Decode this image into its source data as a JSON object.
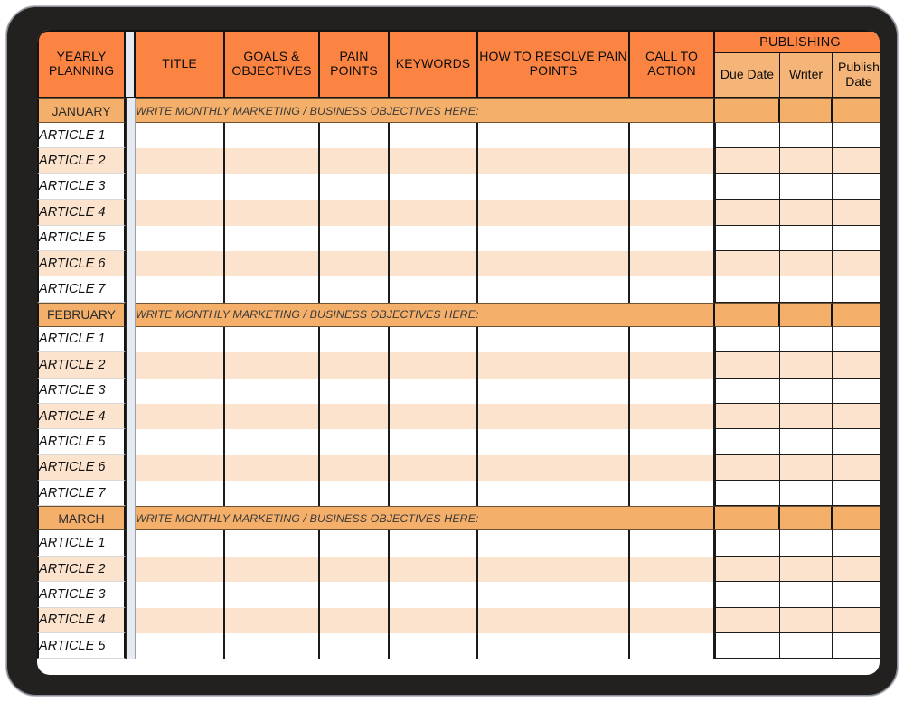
{
  "document": {
    "title": "Yearly Content Planning Spreadsheet",
    "device": "tablet"
  },
  "colors": {
    "header_orange": "#FB8443",
    "subheader_orange": "#F6B578",
    "month_banner": "#F4AF6B",
    "row_alt_peach": "#FBE3CD",
    "row_base": "#FFFFFF",
    "gutter_gray": "#E6EAF1",
    "grid_line": "#141414",
    "bezel": "#232020"
  },
  "header": {
    "corner_label": "YEARLY PLANNING",
    "columns": [
      {
        "label": "TITLE",
        "name": "title"
      },
      {
        "label": "GOALS & OBJECTIVES",
        "name": "goals-objectives"
      },
      {
        "label": "PAIN POINTS",
        "name": "pain-points"
      },
      {
        "label": "KEYWORDS",
        "name": "keywords"
      },
      {
        "label": "HOW TO RESOLVE PAIN POINTS",
        "name": "how-to-resolve-pain-points"
      },
      {
        "label": "CALL TO ACTION",
        "name": "call-to-action"
      }
    ],
    "group": {
      "label": "PUBLISHING",
      "subcolumns": [
        {
          "label": "Due Date",
          "name": "due-date"
        },
        {
          "label": "Writer",
          "name": "writer"
        },
        {
          "label": "Publish Date",
          "name": "publish-date"
        }
      ]
    }
  },
  "objectives_placeholder": "WRITE MONTHLY MARKETING / BUSINESS OBJECTIVES HERE:",
  "months": [
    {
      "name": "JANUARY",
      "objectives": "",
      "rows": [
        "ARTICLE 1",
        "ARTICLE 2",
        "ARTICLE 3",
        "ARTICLE 4",
        "ARTICLE 5",
        "ARTICLE 6",
        "ARTICLE 7"
      ]
    },
    {
      "name": "FEBRUARY",
      "objectives": "",
      "rows": [
        "ARTICLE 1",
        "ARTICLE 2",
        "ARTICLE 3",
        "ARTICLE 4",
        "ARTICLE 5",
        "ARTICLE 6",
        "ARTICLE 7"
      ]
    },
    {
      "name": "MARCH",
      "objectives": "",
      "rows": [
        "ARTICLE 1",
        "ARTICLE 2",
        "ARTICLE 3",
        "ARTICLE 4",
        "ARTICLE 5"
      ]
    }
  ]
}
